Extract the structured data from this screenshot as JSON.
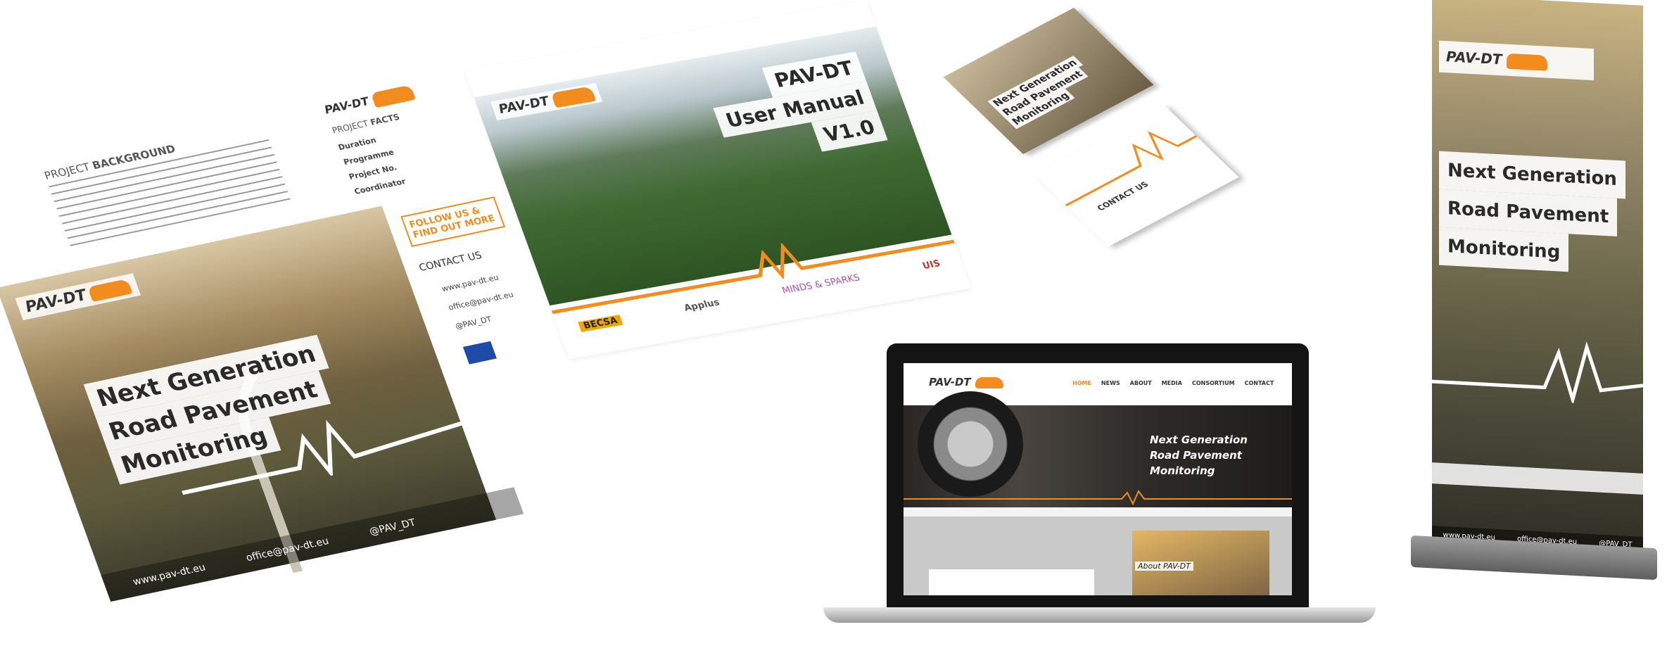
{
  "brand": {
    "name": "PAV-DT",
    "accent": "#f28c1e"
  },
  "flyer": {
    "background_heading_prefix": "PROJECT",
    "background_heading": "BACKGROUND",
    "facts_heading_prefix": "PROJECT",
    "facts_heading": "FACTS",
    "facts_labels": [
      "Duration",
      "Programme",
      "Project No.",
      "Coordinator"
    ],
    "follow": "FOLLOW US & FIND OUT MORE",
    "contact_heading": "CONTACT US",
    "contact_items": [
      "www.pav-dt.eu",
      "office@pav-dt.eu",
      "@PAV_DT"
    ],
    "headline": [
      "Next Generation",
      "Road Pavement",
      "Monitoring"
    ],
    "footer": [
      "www.pav-dt.eu",
      "office@pav-dt.eu",
      "@PAV_DT"
    ]
  },
  "manual": {
    "title_lines": [
      "PAV-DT",
      "User Manual",
      "V1.0"
    ],
    "partners": [
      "BECSA",
      "Applus",
      "MINDS & SPARKS",
      "UIS"
    ]
  },
  "cards": {
    "front_headline": [
      "Next Generation",
      "Road Pavement",
      "Monitoring"
    ],
    "back_heading": "CONTACT US"
  },
  "website": {
    "nav": [
      "HOME",
      "NEWS",
      "ABOUT",
      "MEDIA",
      "CONSORTIUM",
      "CONTACT"
    ],
    "active_nav": "HOME",
    "hero_lines": [
      "Next Generation",
      "Road Pavement",
      "Monitoring"
    ],
    "about_label": "About PAV-DT"
  },
  "rollup": {
    "headline": [
      "Next Generation",
      "Road Pavement",
      "Monitoring"
    ],
    "footer": [
      "www.pav-dt.eu",
      "office@pav-dt.eu",
      "@PAV_DT"
    ]
  }
}
